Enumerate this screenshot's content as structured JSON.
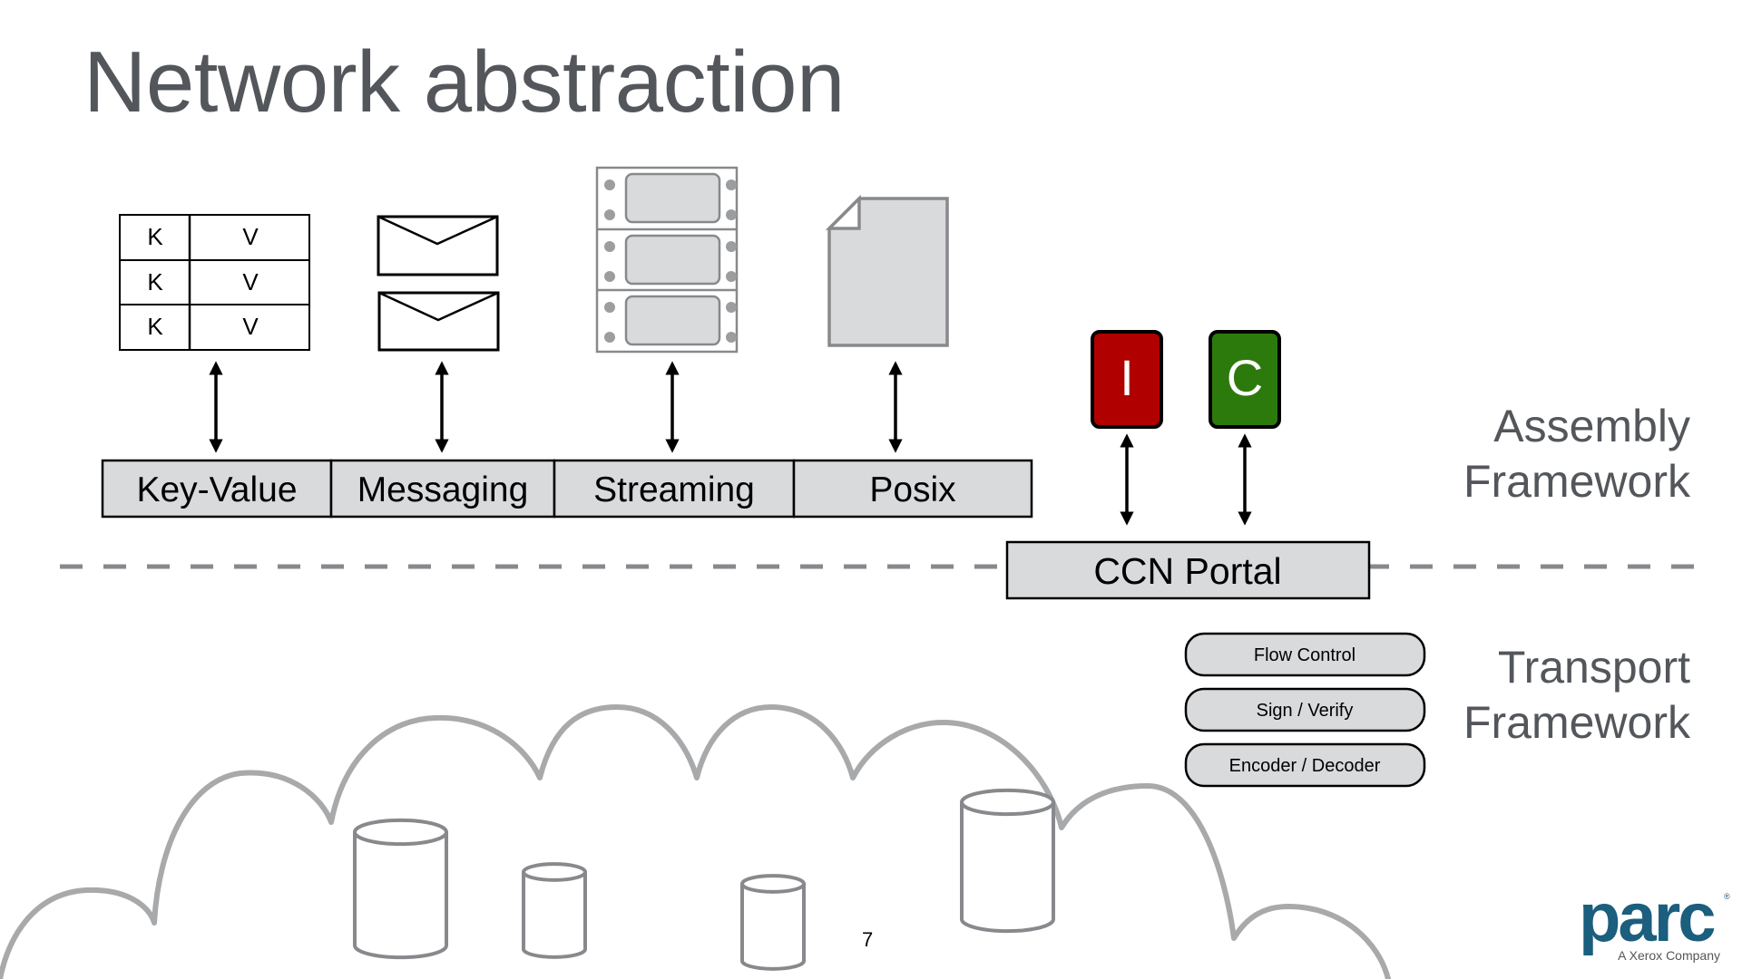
{
  "slide": {
    "title": "Network abstraction",
    "page_number": "7"
  },
  "assembly_icons": {
    "key_value_table": {
      "rows": [
        {
          "key": "K",
          "value": "V"
        },
        {
          "key": "K",
          "value": "V"
        },
        {
          "key": "K",
          "value": "V"
        }
      ]
    },
    "messaging_icon": "envelope-icon",
    "streaming_icon": "filmstrip-icon",
    "posix_icon": "document-icon"
  },
  "api_bar": {
    "segments": [
      {
        "label": "Key-Value"
      },
      {
        "label": "Messaging"
      },
      {
        "label": "Streaming"
      },
      {
        "label": "Posix"
      }
    ]
  },
  "message_tiles": [
    {
      "letter": "I",
      "color": "#b00000"
    },
    {
      "letter": "C",
      "color": "#2d7a0c"
    }
  ],
  "portal": {
    "label": "CCN Portal"
  },
  "transport_stack": [
    {
      "label": "Flow Control"
    },
    {
      "label": "Sign / Verify"
    },
    {
      "label": "Encoder / Decoder"
    }
  ],
  "layer_labels": {
    "assembly": [
      "Assembly",
      "Framework"
    ],
    "transport": [
      "Transport",
      "Framework"
    ]
  },
  "network_cloud": {
    "storage_icon": "database-cylinder-icon",
    "cylinder_count": 4
  },
  "logo": {
    "name": "parc",
    "registered_mark": "®",
    "tagline": "A Xerox Company",
    "color": "#1b5e7e"
  },
  "colors": {
    "title_gray": "#53565a",
    "box_fill": "#d9dadc",
    "icon_gray": "#88898c",
    "cloud_gray": "#a8a9ab"
  }
}
